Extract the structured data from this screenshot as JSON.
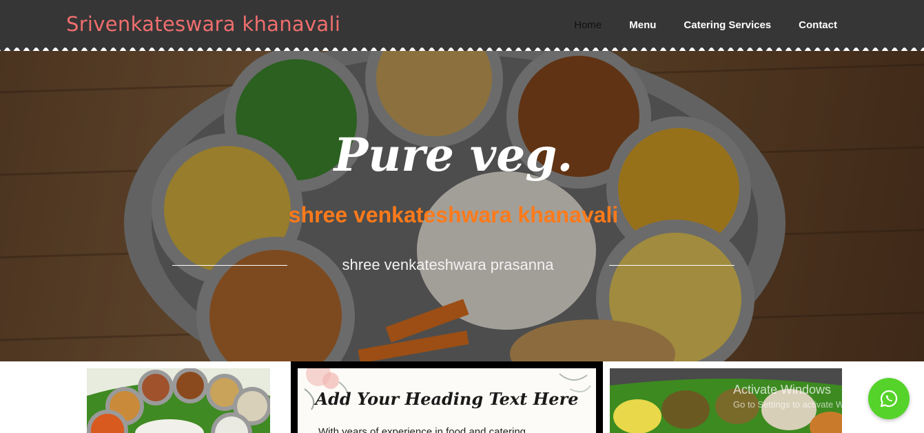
{
  "header": {
    "brand": "Srivenkateswara khanavali",
    "nav": [
      {
        "label": "Home",
        "active": true
      },
      {
        "label": "Menu",
        "active": false
      },
      {
        "label": "Catering Services",
        "active": false
      },
      {
        "label": "Contact",
        "active": false
      }
    ]
  },
  "hero": {
    "title": "Pure veg.",
    "subtitle": "shree venkateshwara khanavali",
    "tagline": "shree venkateshwara prasanna"
  },
  "about_card": {
    "heading": "Add Your Heading Text Here",
    "text": "With years of experience in food and catering"
  },
  "os_watermark": {
    "line1": "Activate Windows",
    "line2": "Go to Settings to activate Windows."
  },
  "icons": {
    "whatsapp": "whatsapp-icon"
  },
  "colors": {
    "header_bg": "#363636",
    "brand": "#f06e6e",
    "subtitle": "#ff7a1a",
    "whatsapp": "#55d32a"
  }
}
